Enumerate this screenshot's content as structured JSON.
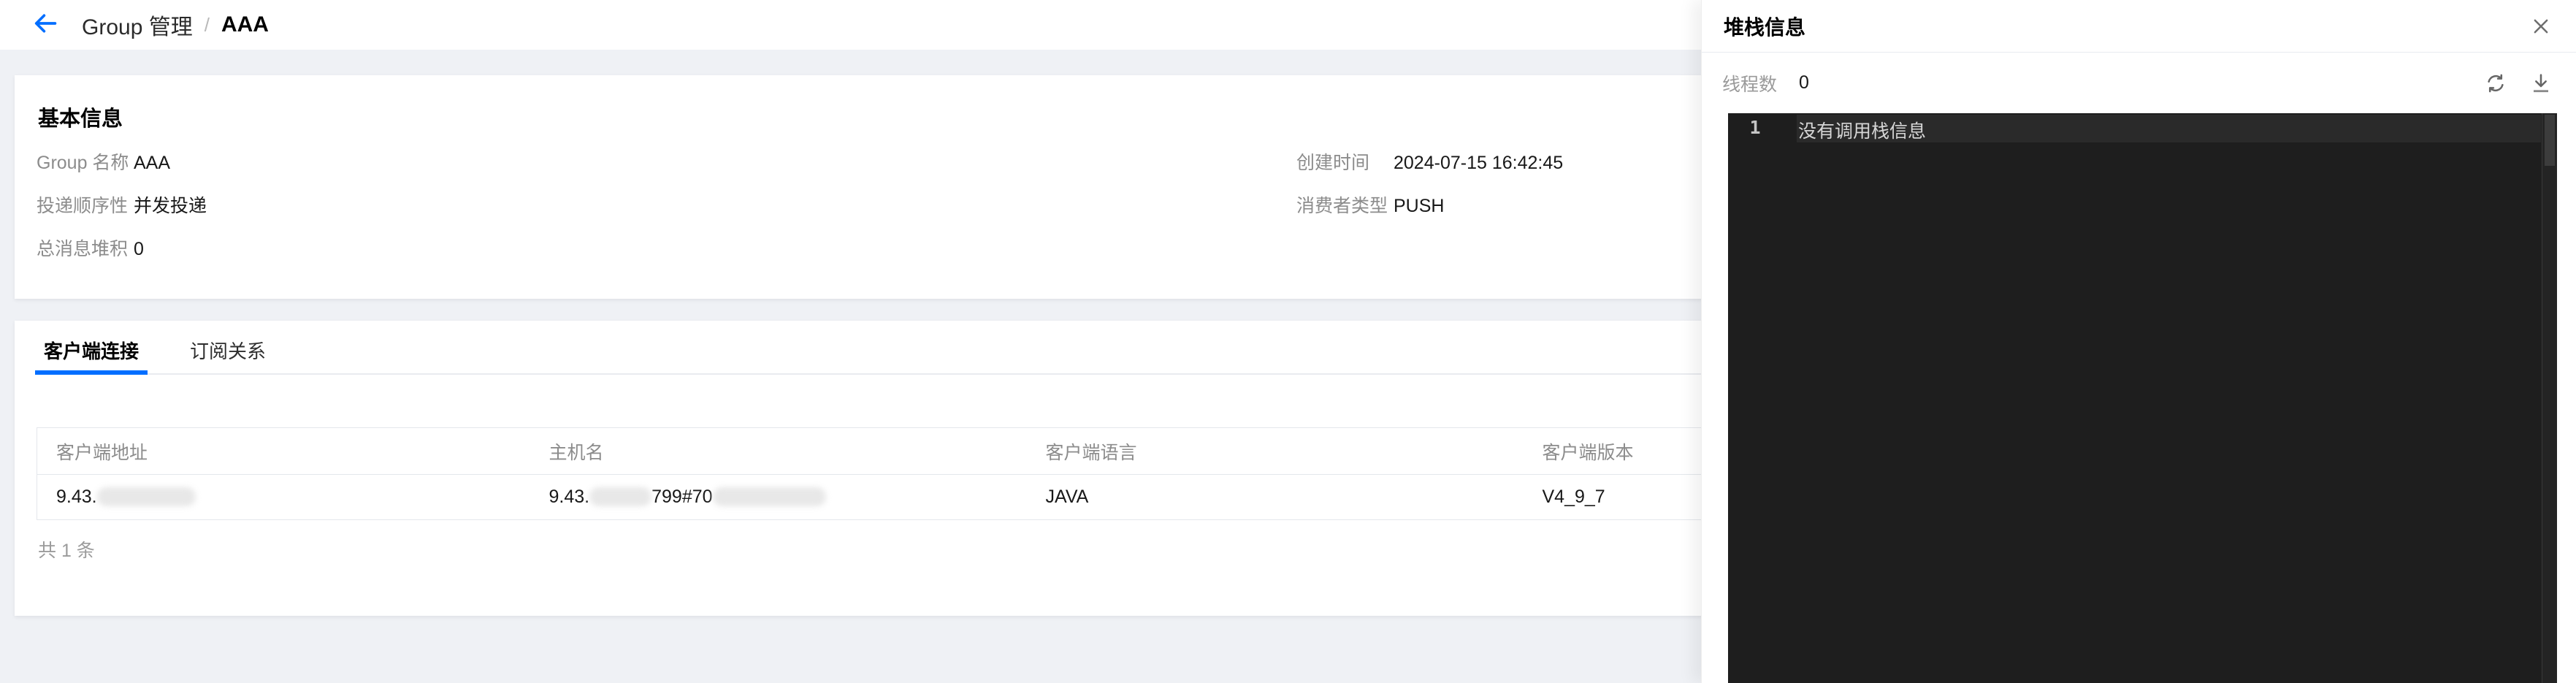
{
  "colors": {
    "accent": "#006eff",
    "page_bg": "#eff1f5",
    "code_bg": "#1e1e1e"
  },
  "breadcrumb": {
    "section": "Group 管理",
    "separator": "/",
    "current": "AAA"
  },
  "icons": {
    "back": "arrow-left",
    "close": "close",
    "refresh": "refresh",
    "download": "download"
  },
  "basic_info": {
    "title": "基本信息",
    "fields": [
      {
        "label": "Group 名称",
        "value": "AAA"
      },
      {
        "label": "创建时间",
        "value": "2024-07-15 16:42:45"
      },
      {
        "label": "投递顺序性",
        "value": "并发投递"
      },
      {
        "label": "消费者类型",
        "value": "PUSH"
      },
      {
        "label": "总消息堆积",
        "value": "0"
      }
    ]
  },
  "tabs": [
    {
      "label": "客户端连接",
      "active": true
    },
    {
      "label": "订阅关系",
      "active": false
    }
  ],
  "client_table": {
    "columns": [
      "客户端地址",
      "主机名",
      "客户端语言",
      "客户端版本"
    ],
    "row": {
      "address_prefix": "9.43.",
      "host_prefix": "9.43.",
      "host_mid": "799#70",
      "language": "JAVA",
      "version": "V4_9_7"
    },
    "total_text": "共 1 条"
  },
  "drawer": {
    "title": "堆栈信息",
    "thread_count_label": "线程数",
    "thread_count_value": "0",
    "code": {
      "line_number": "1",
      "line_text": "没有调用栈信息"
    }
  }
}
